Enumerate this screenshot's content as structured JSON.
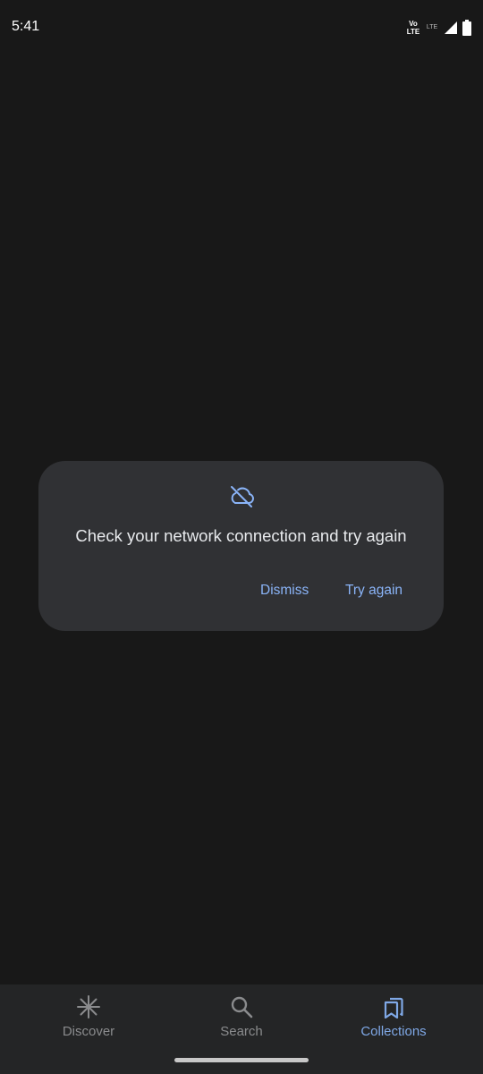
{
  "status_bar": {
    "time": "5:41",
    "volte_top": "Vo",
    "volte_bottom": "LTE",
    "lte2_label": "LTE",
    "icons": [
      "volte-icon",
      "lte2-icon",
      "signal-icon",
      "battery-icon"
    ]
  },
  "dialog": {
    "icon": "cloud-off-icon",
    "message": "Check your network connection and try again",
    "dismiss_label": "Dismiss",
    "retry_label": "Try again"
  },
  "bottom_nav": {
    "items": [
      {
        "label": "Discover",
        "icon": "asterisk-icon",
        "active": false
      },
      {
        "label": "Search",
        "icon": "search-icon",
        "active": false
      },
      {
        "label": "Collections",
        "icon": "bookmarks-icon",
        "active": true
      }
    ]
  },
  "colors": {
    "background": "#181818",
    "dialog_bg": "#303134",
    "accent": "#8ab4f8",
    "nav_bg": "#242526",
    "nav_active": "#7fa8e6",
    "nav_inactive": "#8a8b8d"
  }
}
